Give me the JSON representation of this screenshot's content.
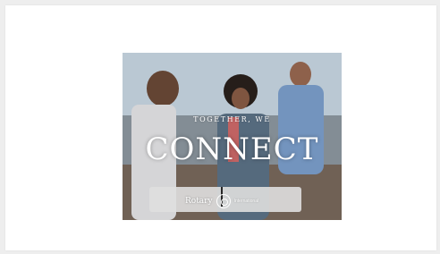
{
  "banner": {
    "headline_top": "TOGETHER, WE",
    "headline_main": "CONNECT",
    "brand_name": "Rotary",
    "brand_tagline": "International"
  },
  "colors": {
    "page_background": "#eeeeee",
    "card_background": "#ffffff",
    "overlay_text": "#ffffff"
  },
  "icons": {
    "brand_logo": "rotary-wheel-icon"
  }
}
